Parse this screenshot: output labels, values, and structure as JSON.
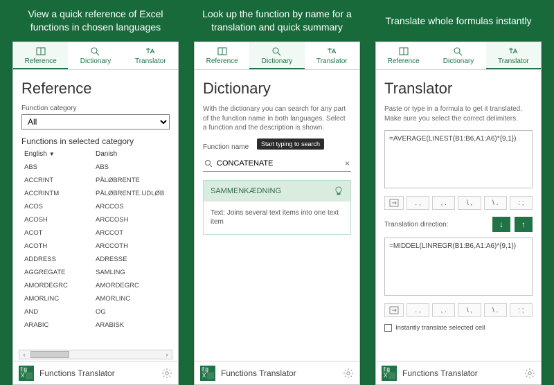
{
  "captions": {
    "reference": "View a quick reference of Excel functions in chosen languages",
    "dictionary": "Look up the function by name for a translation and quick summary",
    "translator": "Translate whole formulas instantly"
  },
  "tabs": {
    "reference": "Reference",
    "dictionary": "Dictionary",
    "translator": "Translator"
  },
  "footer": {
    "title": "Functions Translator"
  },
  "reference": {
    "title": "Reference",
    "category_label": "Function category",
    "category_value": "All",
    "list_heading": "Functions in selected category",
    "col1": "English",
    "col2": "Danish",
    "rows": [
      {
        "en": "ABS",
        "da": "ABS"
      },
      {
        "en": "ACCRINT",
        "da": "PÅLØBRENTE"
      },
      {
        "en": "ACCRINTM",
        "da": "PÅLØBRENTE.UDLØB"
      },
      {
        "en": "ACOS",
        "da": "ARCCOS"
      },
      {
        "en": "ACOSH",
        "da": "ARCCOSH"
      },
      {
        "en": "ACOT",
        "da": "ARCCOT"
      },
      {
        "en": "ACOTH",
        "da": "ARCCOTH"
      },
      {
        "en": "ADDRESS",
        "da": "ADRESSE"
      },
      {
        "en": "AGGREGATE",
        "da": "SAMLING"
      },
      {
        "en": "AMORDEGRC",
        "da": "AMORDEGRC"
      },
      {
        "en": "AMORLINC",
        "da": "AMORLINC"
      },
      {
        "en": "AND",
        "da": "OG"
      },
      {
        "en": "ARABIC",
        "da": "ARABISK"
      }
    ]
  },
  "dictionary": {
    "title": "Dictionary",
    "description": "With the dictionary you can search for any part of the function name in both languages. Select a function and the description is shown.",
    "fn_label": "Function name",
    "tooltip": "Start typing to search",
    "search_value": "CONCATENATE",
    "result_name": "SAMMENKÆDNING",
    "result_desc": "Text: Joins several text items into one text item"
  },
  "translator": {
    "title": "Translator",
    "description": "Paste or type in a formula to get it translated. Make sure you select the correct delimiters.",
    "input_value": "=AVERAGE(LINEST(B1:B6,A1:A6)*{9,1})",
    "direction_label": "Translation direction:",
    "output_value": "=MIDDEL(LINREGR(B1:B6,A1:A6)*{9,1})",
    "checkbox_label": "Instantly translate selected cell",
    "fmt": {
      "a": ". ,",
      "b": ", .",
      "c": "\\ ,",
      "d": "\\ .",
      "e": ": ;"
    }
  }
}
